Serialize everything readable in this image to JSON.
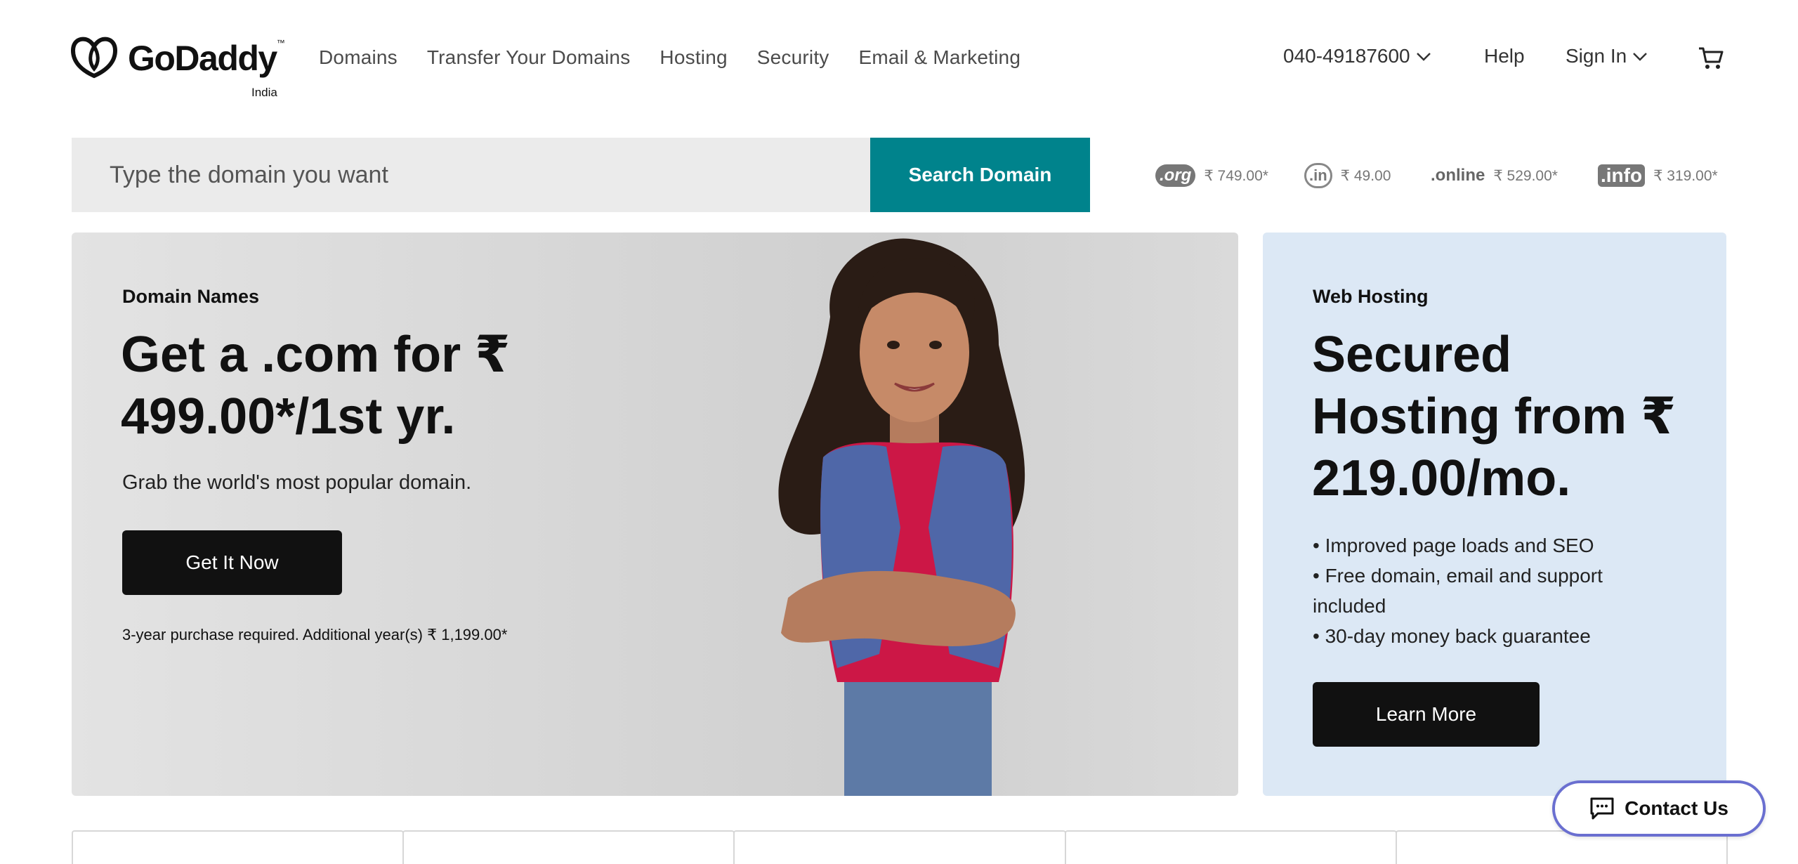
{
  "header": {
    "logo_text": "GoDaddy",
    "logo_tm": "™",
    "country": "India",
    "nav": [
      "Domains",
      "Transfer Your Domains",
      "Hosting",
      "Security",
      "Email & Marketing"
    ],
    "phone": "040-49187600",
    "help": "Help",
    "sign_in": "Sign In",
    "cart_icon": "cart-icon"
  },
  "search": {
    "placeholder": "Type the domain you want",
    "button": "Search Domain"
  },
  "tlds": [
    {
      "logo": ".org",
      "price": "₹ 749.00*"
    },
    {
      "logo": ".in",
      "price": "₹ 49.00"
    },
    {
      "logo": ".online",
      "price": "₹ 529.00*"
    },
    {
      "logo": ".info",
      "price": "₹ 319.00*"
    }
  ],
  "hero": {
    "kicker": "Domain Names",
    "title": "Get a .com for ₹ 499.00*/1st yr.",
    "subtitle": "Grab the world's most popular domain.",
    "button": "Get It Now",
    "note": "3-year purchase required. Additional year(s) ₹ 1,199.00*"
  },
  "hosting": {
    "kicker": "Web Hosting",
    "title": "Secured Hosting from ₹ 219.00/mo.",
    "bullets": [
      "• Improved page loads and SEO",
      "• Free domain, email and support included",
      "• 30-day money back guarantee"
    ],
    "button": "Learn More"
  },
  "contact": {
    "label": "Contact Us"
  },
  "colors": {
    "search_button": "#00838c",
    "hosting_card": "#dce8f5",
    "dark_button": "#111111",
    "contact_border": "#6a6fd0"
  }
}
